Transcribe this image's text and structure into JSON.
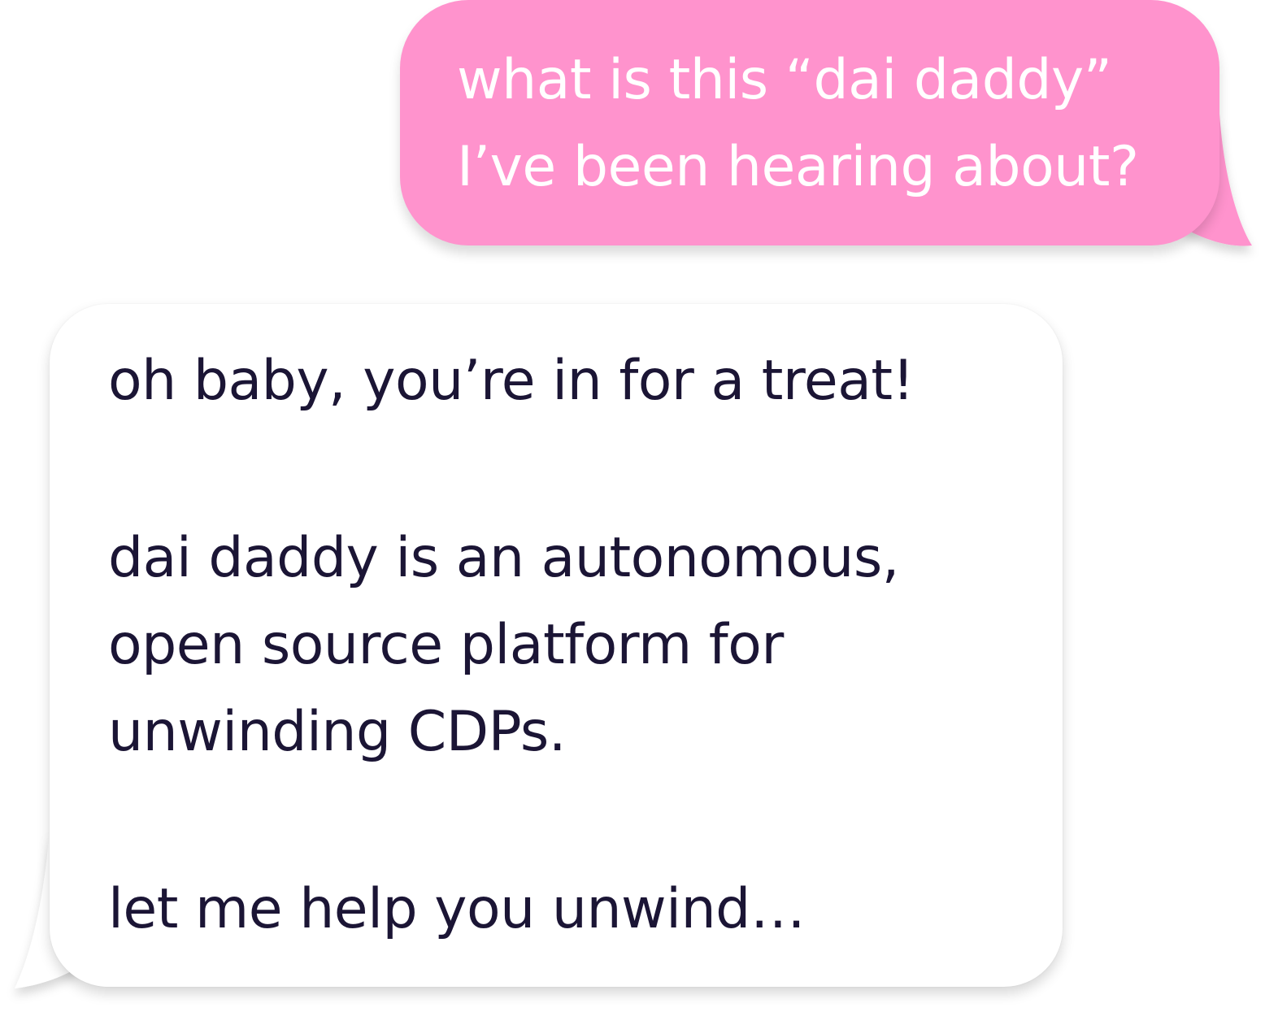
{
  "conversation": {
    "sent_message": {
      "lines": [
        "what is this “dai daddy”",
        "I’ve been hearing about?"
      ],
      "bubble_color": "#ff93cd",
      "text_color": "#ffffff"
    },
    "received_message": {
      "lines": [
        "oh baby, you’re in for a treat!",
        "dai daddy is an autonomous,",
        "open source platform for",
        "unwinding CDPs.",
        "let me help you unwind…"
      ],
      "bubble_color": "#ffffff",
      "text_color": "#1b1535"
    }
  }
}
